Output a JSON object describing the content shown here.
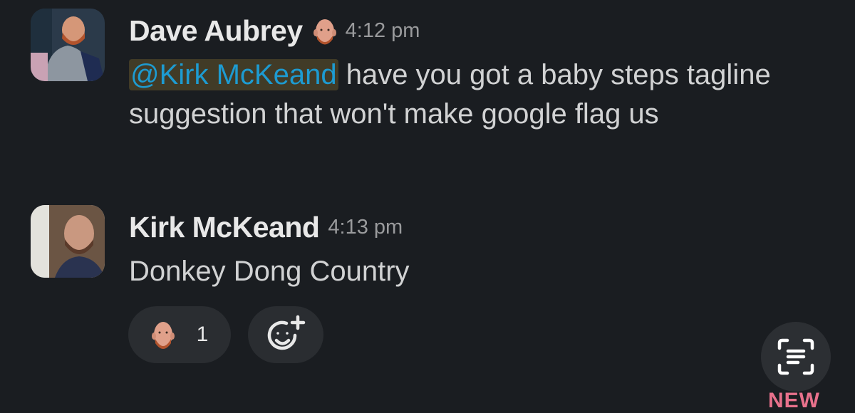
{
  "messages": [
    {
      "author": "Dave Aubrey",
      "time": "4:12 pm",
      "mention": "@Kirk McKeand",
      "text": " have you got a baby steps tagline suggestion that won't make google flag us"
    },
    {
      "author": "Kirk McKeand",
      "time": "4:13 pm",
      "text": "Donkey Dong Country",
      "reactions": [
        {
          "icon": "bald-face-emoji-icon",
          "count": "1"
        }
      ],
      "add_reaction_icon": "add-reaction-icon"
    }
  ],
  "scan_button_icon": "scan-text-icon",
  "new_label": "NEW",
  "colors": {
    "background": "#1a1d21",
    "mention_text": "#1d9bd1",
    "new_label": "#e8718c"
  }
}
